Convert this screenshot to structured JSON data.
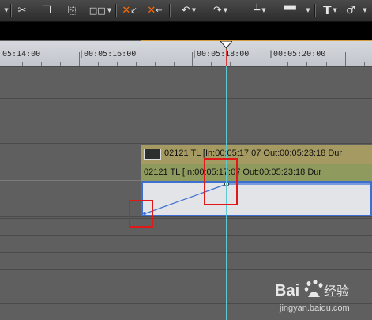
{
  "toolbar": {
    "items": [
      {
        "name": "cut",
        "glyph": "✂"
      },
      {
        "name": "copy",
        "glyph": "❐"
      },
      {
        "name": "paste",
        "glyph": "⎘"
      },
      {
        "name": "clip-mode",
        "glyph": "□□"
      },
      {
        "name": "delete-in",
        "glyph": "✕"
      },
      {
        "name": "ripple-delete",
        "glyph": "✕"
      },
      {
        "name": "undo",
        "glyph": "↶"
      },
      {
        "name": "redo",
        "glyph": "↷"
      },
      {
        "name": "audio-level",
        "glyph": "┴"
      },
      {
        "name": "transition",
        "glyph": "▀▀"
      },
      {
        "name": "title",
        "glyph": "T"
      },
      {
        "name": "voiceover",
        "glyph": "♂"
      }
    ]
  },
  "ruler": {
    "labels": [
      "05:14:00",
      "|00:05:16:00",
      "|00:05:18:00",
      "|00:05:20:00"
    ]
  },
  "clips": {
    "video": {
      "text": "02121   TL [In:00:05:17:07 Out:00:05:23:18 Dur"
    },
    "audio": {
      "text": "02121   TL [In:00:05:17:07 Out:00:05:23:18 Dur"
    }
  },
  "watermark": {
    "site": "jingyan.baidu.com"
  },
  "colors": {
    "playhead": "#5ec8d0",
    "highlight": "#e01818",
    "rubberband": "#3d6fd0"
  }
}
